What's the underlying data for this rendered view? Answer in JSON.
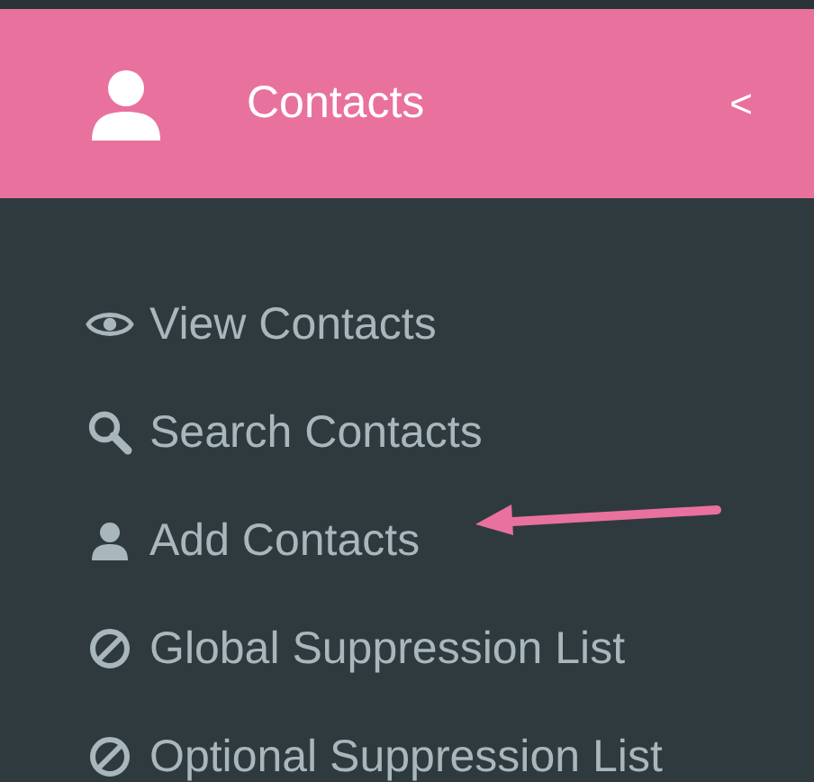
{
  "header": {
    "title": "Contacts",
    "toggle": "<"
  },
  "menu": [
    {
      "label": "View Contacts"
    },
    {
      "label": "Search Contacts"
    },
    {
      "label": "Add Contacts"
    },
    {
      "label": "Global Suppression List"
    },
    {
      "label": "Optional Suppression List"
    }
  ]
}
